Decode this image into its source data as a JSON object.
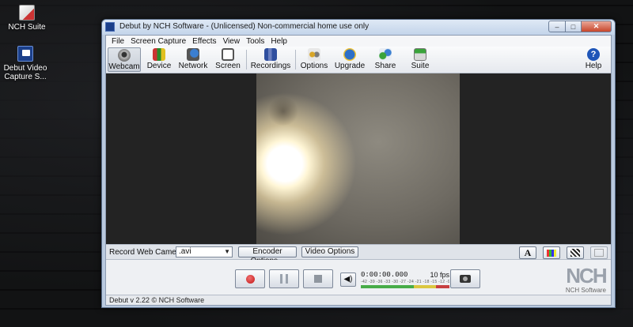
{
  "desktop": {
    "icons": [
      {
        "label": "NCH Suite"
      },
      {
        "label": "Debut Video Capture S..."
      }
    ]
  },
  "window": {
    "title": "Debut by NCH Software - (Unlicensed) Non-commercial home use only",
    "controls": {
      "minimize": "–",
      "maximize": "□",
      "close": "✕"
    }
  },
  "menu": [
    "File",
    "Screen Capture",
    "Effects",
    "View",
    "Tools",
    "Help"
  ],
  "toolbar": {
    "webcam": "Webcam",
    "device": "Device",
    "network": "Network",
    "screen": "Screen",
    "recordings": "Recordings",
    "options": "Options",
    "upgrade": "Upgrade",
    "share": "Share",
    "suite": "Suite",
    "help": "Help",
    "help_glyph": "?"
  },
  "record_bar": {
    "label": "Record Web Camera as:",
    "format": ".avi",
    "encoder_options": "Encoder Options...",
    "video_options": "Video Options",
    "text_glyph": "A"
  },
  "controls": {
    "volume_glyph": "◀)",
    "time": "0:00:00.000",
    "fps": "10 fps",
    "meter_scale": "-42 -39 -36 -33 -30 -27 -24 -21 -18 -15 -12 -9 -6 -3 0",
    "logo": "NCH",
    "logo_sub": "NCH Software"
  },
  "status": "Debut v 2.22 © NCH Software",
  "colors": {
    "record": "#c31414",
    "accent": "#1f56b8"
  }
}
